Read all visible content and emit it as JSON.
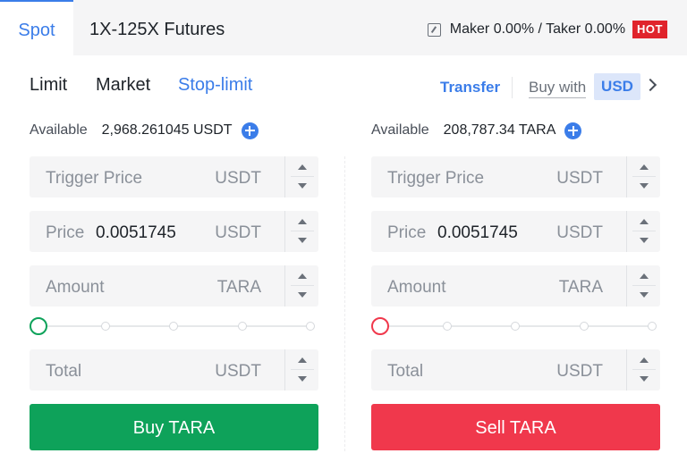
{
  "tabs": {
    "spot": "Spot",
    "futures": "1X-125X Futures"
  },
  "fees": {
    "text": "Maker 0.00% / Taker 0.00%",
    "badge": "HOT"
  },
  "order_types": {
    "limit": "Limit",
    "market": "Market",
    "stop_limit": "Stop-limit",
    "active": "Stop-limit"
  },
  "actions": {
    "transfer": "Transfer",
    "buy_with": "Buy with",
    "currency": "USD"
  },
  "buy": {
    "available_label": "Available",
    "available_value": "2,968.261045 USDT",
    "trigger_label": "Trigger Price",
    "trigger_unit": "USDT",
    "price_label": "Price",
    "price_value": "0.0051745",
    "price_unit": "USDT",
    "amount_label": "Amount",
    "amount_unit": "TARA",
    "total_label": "Total",
    "total_unit": "USDT",
    "slider_percent": 0,
    "button": "Buy TARA"
  },
  "sell": {
    "available_label": "Available",
    "available_value": "208,787.34 TARA",
    "trigger_label": "Trigger Price",
    "trigger_unit": "USDT",
    "price_label": "Price",
    "price_value": "0.0051745",
    "price_unit": "USDT",
    "amount_label": "Amount",
    "amount_unit": "TARA",
    "total_label": "Total",
    "total_unit": "USDT",
    "slider_percent": 0,
    "button": "Sell TARA"
  },
  "colors": {
    "accent": "#3b7de9",
    "buy": "#0ea25a",
    "sell": "#f0384c",
    "hot": "#e0242c"
  }
}
